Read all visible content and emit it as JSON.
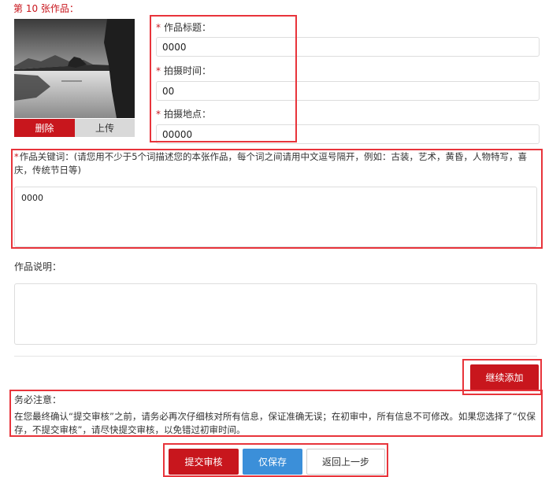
{
  "entry": {
    "title": "第 10 张作品："
  },
  "photo": {
    "delete_label": "删除",
    "upload_label": "上传"
  },
  "fields": {
    "title": {
      "label": "作品标题：",
      "value": "0000"
    },
    "shoot_time": {
      "label": "拍摄时间：",
      "value": "00"
    },
    "location": {
      "label": "拍摄地点：",
      "value": "00000"
    }
  },
  "keywords": {
    "label": "作品关键词：(请您用不少于5个词描述您的本张作品，每个词之间请用中文逗号隔开，例如：古装，艺术，黄昏，人物特写，喜庆，传统节日等)",
    "value": "0000"
  },
  "description": {
    "label": "作品说明：",
    "value": ""
  },
  "add_more_label": "继续添加",
  "notice": {
    "title": "务必注意：",
    "body": "在您最终确认“提交审核”之前，请务必再次仔细核对所有信息，保证准确无误；在初审中，所有信息不可修改。如果您选择了“仅保存，不提交审核”，请尽快提交审核，以免错过初审时间。"
  },
  "footer": {
    "submit_label": "提交审核",
    "save_label": "仅保存",
    "back_label": "返回上一步"
  },
  "colors": {
    "brand_red": "#c8161d",
    "save_blue": "#3b8fd9",
    "highlight": "#e8343b"
  }
}
